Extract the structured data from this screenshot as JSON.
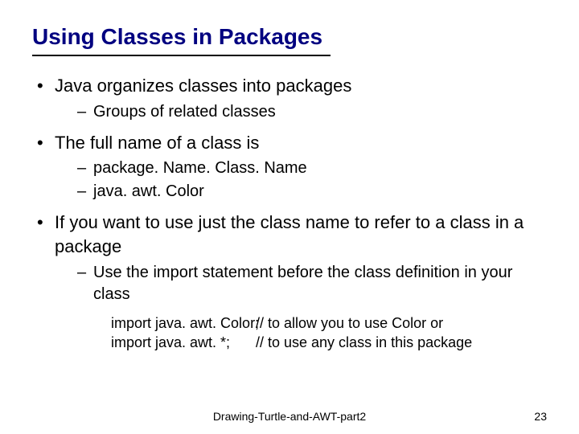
{
  "slide": {
    "title": "Using Classes in Packages",
    "bullets": {
      "b1": "Java organizes classes into packages",
      "b1_sub1": "Groups of related classes",
      "b2": "The full name of a class is",
      "b2_sub1": "package. Name. Class. Name",
      "b2_sub2": "java. awt. Color",
      "b3": "If you want to use just the class name to refer to a class in a package",
      "b3_sub1": "Use the import statement before the class definition in your class"
    },
    "code": {
      "line1_stmt": "import java. awt. Color;",
      "line1_comment": "// to allow you to use Color or",
      "line2_stmt": "import java. awt. *;",
      "line2_comment": "// to use any class in this package"
    },
    "footer": "Drawing-Turtle-and-AWT-part2",
    "page_number": "23"
  }
}
